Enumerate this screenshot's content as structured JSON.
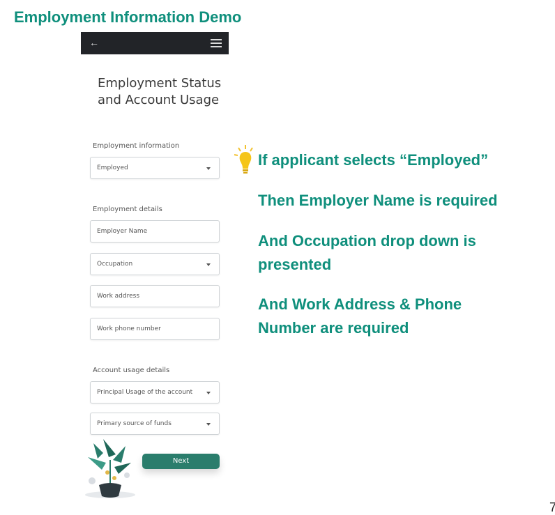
{
  "slide": {
    "title": "Employment Information Demo",
    "page_number": "7"
  },
  "app": {
    "header": {
      "back_icon": "arrow-left-icon",
      "menu_icon": "hamburger-menu-icon"
    },
    "screen_title_line1": "Employment Status",
    "screen_title_line2": "and Account Usage",
    "sections": {
      "employment_information": "Employment information",
      "employment_details": "Employment details",
      "account_usage_details": "Account usage details"
    },
    "fields": {
      "employment_status": {
        "value": "Employed",
        "type": "select"
      },
      "employer_name": {
        "placeholder": "Employer Name",
        "type": "text"
      },
      "occupation": {
        "placeholder": "Occupation",
        "type": "select"
      },
      "work_address": {
        "placeholder": "Work address",
        "type": "text"
      },
      "work_phone": {
        "placeholder": "Work phone number",
        "type": "text"
      },
      "principal_usage": {
        "placeholder": "Principal Usage of the account",
        "type": "select"
      },
      "source_of_funds": {
        "placeholder": "Primary source of funds",
        "type": "select"
      }
    },
    "next_button": "Next",
    "illustration": "plant-pot-illustration"
  },
  "notes": {
    "icon": "lightbulb-icon",
    "line1": "If applicant selects “Employed”",
    "line2": "Then Employer Name is required",
    "line3a": "And Occupation drop down is",
    "line3b": "presented",
    "line4a": "And Work Address & Phone",
    "line4b": "Number are required"
  },
  "colors": {
    "accent": "#0f8f7c",
    "button": "#2a7d6c",
    "header_bar": "#222428"
  }
}
